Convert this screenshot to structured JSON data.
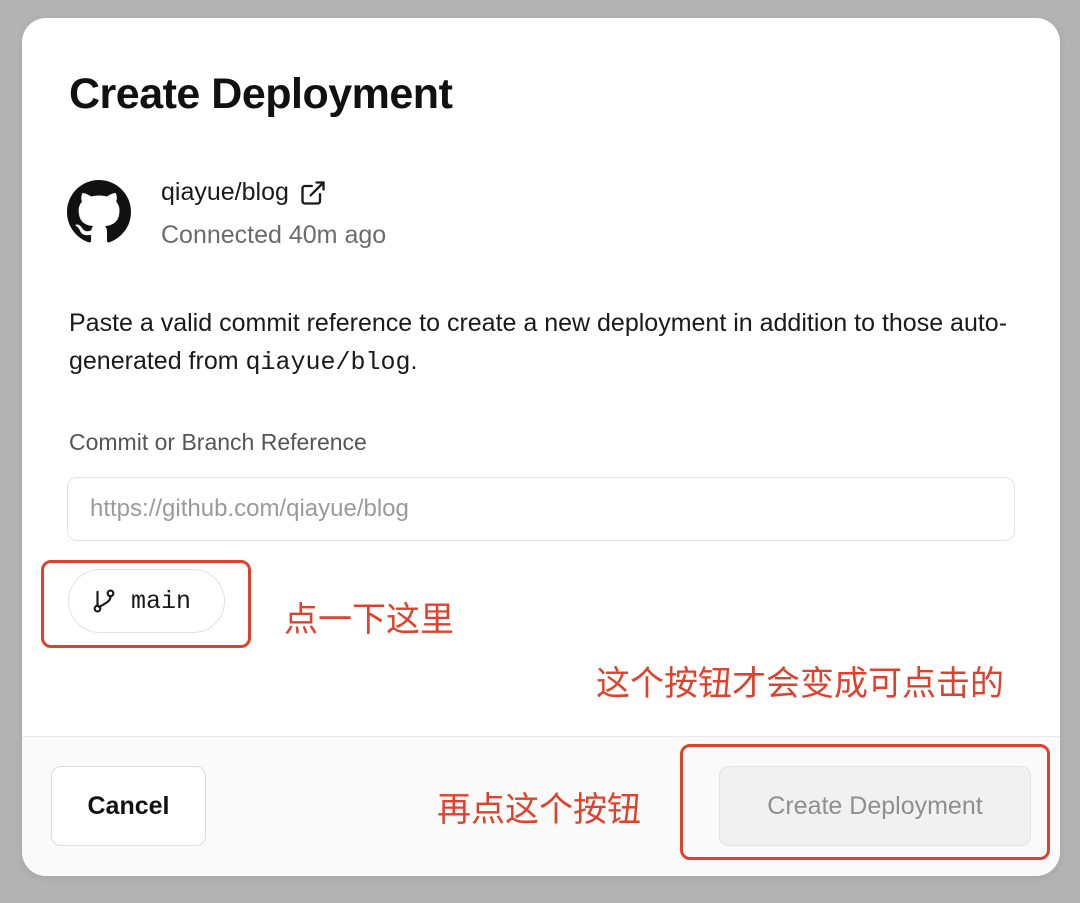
{
  "dialog": {
    "title": "Create Deployment"
  },
  "repo": {
    "name": "qiayue/blog",
    "status": "Connected 40m ago",
    "icon": "github-icon",
    "link_icon": "external-link-icon"
  },
  "description": {
    "text_before": "Paste a valid commit reference to create a new deployment in addition to those auto-generated from ",
    "repo_code": "qiayue/blog",
    "text_after": "."
  },
  "reference": {
    "label": "Commit or Branch Reference",
    "value": "",
    "placeholder": "https://github.com/qiayue/blog"
  },
  "branch": {
    "name": "main",
    "icon": "git-branch-icon"
  },
  "annotations": {
    "click_here": "点一下这里",
    "button_enabled": "这个按钮才会变成可点击的",
    "click_button": "再点这个按钮"
  },
  "footer": {
    "cancel_label": "Cancel",
    "create_label": "Create Deployment"
  },
  "colors": {
    "annotation": "#e0412d",
    "disabled_text": "#8f8f8f",
    "overlay": "#b3b3b3"
  }
}
